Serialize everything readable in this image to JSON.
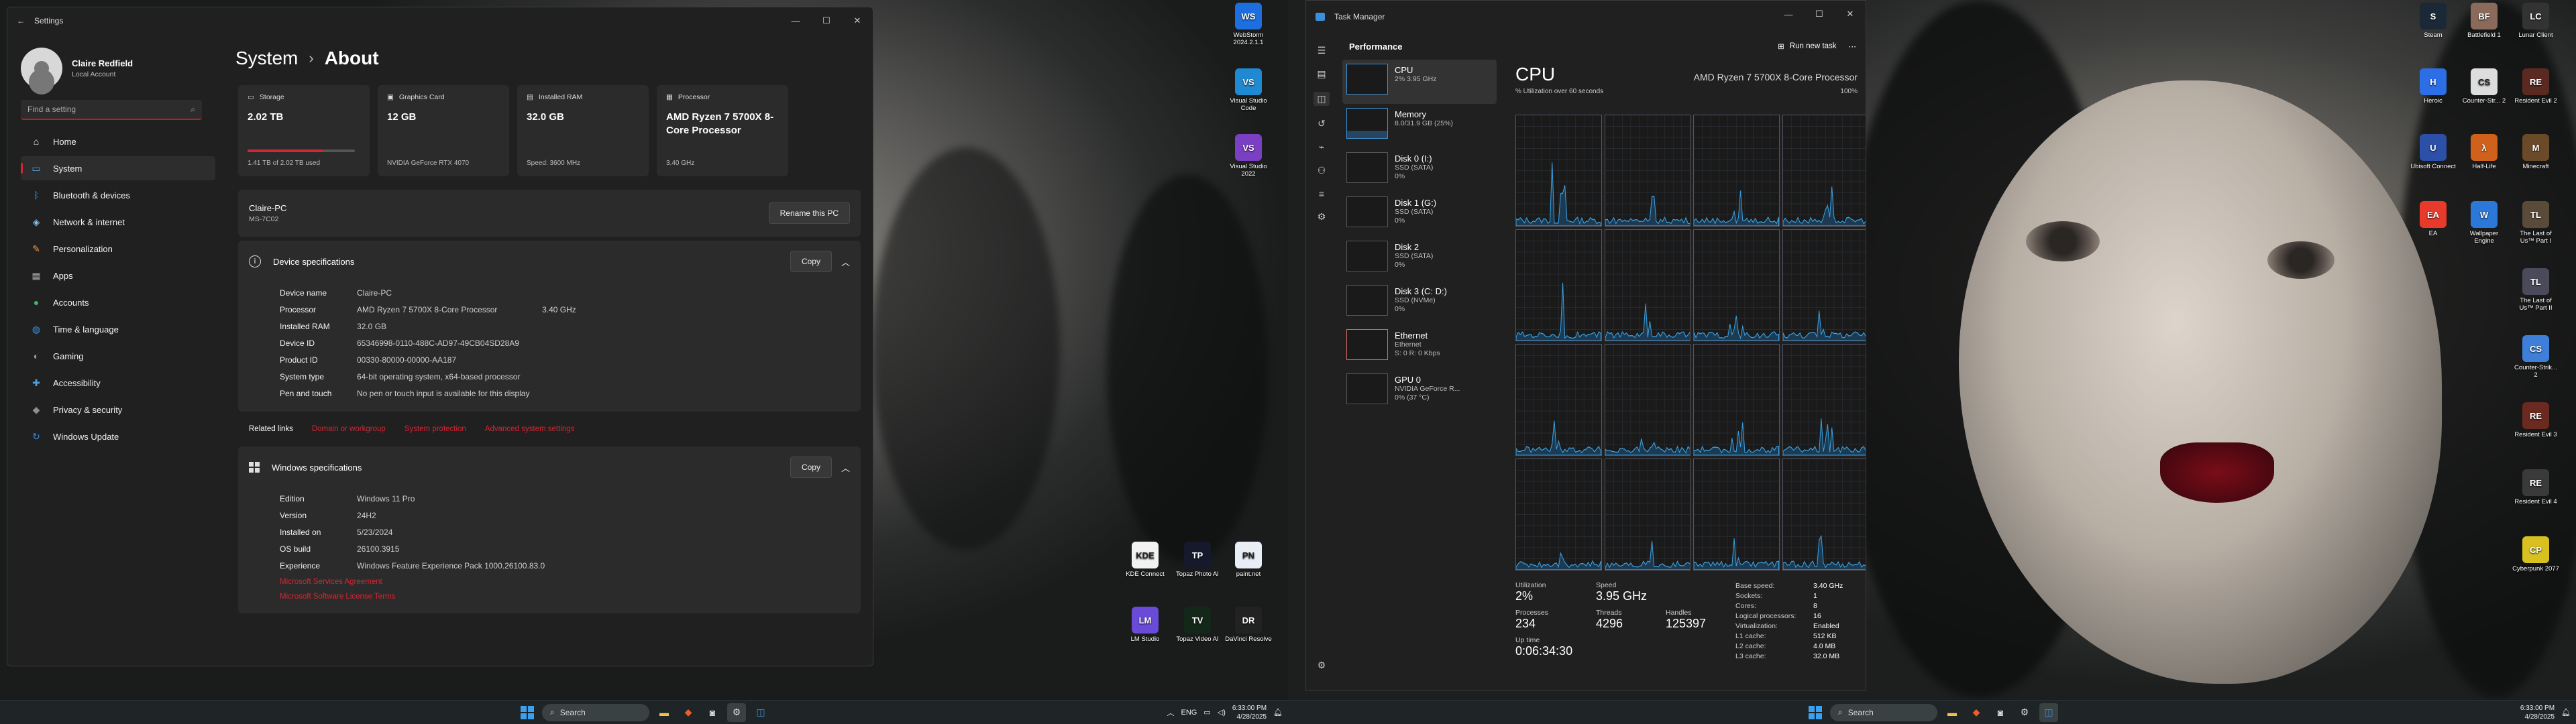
{
  "settings": {
    "title": "Settings",
    "profile": {
      "name": "Claire Redfield",
      "sub": "Local Account"
    },
    "search_placeholder": "Find a setting",
    "nav": [
      {
        "label": "Home",
        "icon": "home-icon",
        "glyph": "⌂",
        "color": "#e8e8e8"
      },
      {
        "label": "System",
        "icon": "system-icon",
        "glyph": "▭",
        "color": "#4aa3df"
      },
      {
        "label": "Bluetooth & devices",
        "icon": "bluetooth-icon",
        "glyph": "ᛒ",
        "color": "#2b8fe0"
      },
      {
        "label": "Network & internet",
        "icon": "wifi-icon",
        "glyph": "◈",
        "color": "#7dc4f5"
      },
      {
        "label": "Personalization",
        "icon": "brush-icon",
        "glyph": "✎",
        "color": "#e89a3c"
      },
      {
        "label": "Apps",
        "icon": "apps-icon",
        "glyph": "▦",
        "color": "#9aa0a6"
      },
      {
        "label": "Accounts",
        "icon": "accounts-icon",
        "glyph": "●",
        "color": "#3fb36b"
      },
      {
        "label": "Time & language",
        "icon": "globe-icon",
        "glyph": "◍",
        "color": "#3c91e6"
      },
      {
        "label": "Gaming",
        "icon": "gamepad-icon",
        "glyph": "◐",
        "color": "#9aa0a6"
      },
      {
        "label": "Accessibility",
        "icon": "accessibility-icon",
        "glyph": "✚",
        "color": "#4aa3df"
      },
      {
        "label": "Privacy & security",
        "icon": "shield-icon",
        "glyph": "◆",
        "color": "#8a8f95"
      },
      {
        "label": "Windows Update",
        "icon": "update-icon",
        "glyph": "↻",
        "color": "#2b8fe0"
      }
    ],
    "active_index": 1,
    "breadcrumb": {
      "parent": "System",
      "sep": "›",
      "current": "About"
    },
    "cards": [
      {
        "title": "Storage",
        "value": "2.02 TB",
        "sub": "1.41 TB of 2.02 TB used",
        "fill": 0.7
      },
      {
        "title": "Graphics Card",
        "value": "12 GB",
        "sub": "NVIDIA GeForce RTX 4070"
      },
      {
        "title": "Installed RAM",
        "value": "32.0 GB",
        "sub": "Speed: 3600 MHz"
      },
      {
        "title": "Processor",
        "value": "AMD Ryzen 7 5700X 8-Core Processor",
        "sub": "3.40 GHz"
      }
    ],
    "pc": {
      "name": "Claire-PC",
      "model": "MS-7C02",
      "rename": "Rename this PC"
    },
    "device_spec": {
      "title": "Device specifications",
      "copy": "Copy",
      "rows": [
        {
          "k": "Device name",
          "v": "Claire-PC"
        },
        {
          "k": "Processor",
          "v": "AMD Ryzen 7 5700X 8-Core Processor                    3.40 GHz"
        },
        {
          "k": "Installed RAM",
          "v": "32.0 GB"
        },
        {
          "k": "Device ID",
          "v": "65346998-0110-488C-AD97-49CB04SD28A9"
        },
        {
          "k": "Product ID",
          "v": "00330-80000-00000-AA187"
        },
        {
          "k": "System type",
          "v": "64-bit operating system, x64-based processor"
        },
        {
          "k": "Pen and touch",
          "v": "No pen or touch input is available for this display"
        }
      ]
    },
    "related": {
      "label": "Related links",
      "links": [
        "Domain or workgroup",
        "System protection",
        "Advanced system settings"
      ]
    },
    "win_spec": {
      "title": "Windows specifications",
      "copy": "Copy",
      "rows": [
        {
          "k": "Edition",
          "v": "Windows 11 Pro"
        },
        {
          "k": "Version",
          "v": "24H2"
        },
        {
          "k": "Installed on",
          "v": "5/23/2024"
        },
        {
          "k": "OS build",
          "v": "26100.3915"
        },
        {
          "k": "Experience",
          "v": "Windows Feature Experience Pack 1000.26100.83.0"
        }
      ],
      "links": [
        "Microsoft Services Agreement",
        "Microsoft Software License Terms"
      ]
    }
  },
  "taskmgr": {
    "title": "Task Manager",
    "section": "Performance",
    "run_task": "Run new task",
    "items": [
      {
        "name": "CPU",
        "l1": "2% 3.95 GHz",
        "l2": ""
      },
      {
        "name": "Memory",
        "l1": "8.0/31.9 GB (25%)",
        "l2": ""
      },
      {
        "name": "Disk 0 (I:)",
        "l1": "SSD (SATA)",
        "l2": "0%"
      },
      {
        "name": "Disk 1 (G:)",
        "l1": "SSD (SATA)",
        "l2": "0%"
      },
      {
        "name": "Disk 2",
        "l1": "SSD (SATA)",
        "l2": "0%"
      },
      {
        "name": "Disk 3 (C: D:)",
        "l1": "SSD (NVMe)",
        "l2": "0%"
      },
      {
        "name": "Ethernet",
        "l1": "Ethernet",
        "l2": "S: 0 R: 0 Kbps"
      },
      {
        "name": "GPU 0",
        "l1": "NVIDIA GeForce R...",
        "l2": "0% (37 °C)"
      }
    ],
    "cpu": {
      "title": "CPU",
      "proc": "AMD Ryzen 7 5700X 8-Core Processor",
      "util_label": "% Utilization over 60 seconds",
      "util_max": "100%",
      "utilization_label": "Utilization",
      "utilization": "2%",
      "speed_label": "Speed",
      "speed": "3.95 GHz",
      "processes_label": "Processes",
      "processes": "234",
      "threads_label": "Threads",
      "threads": "4296",
      "handles_label": "Handles",
      "handles": "125397",
      "uptime_label": "Up time",
      "uptime": "0:06:34:30",
      "details": [
        {
          "k": "Base speed:",
          "v": "3.40 GHz"
        },
        {
          "k": "Sockets:",
          "v": "1"
        },
        {
          "k": "Cores:",
          "v": "8"
        },
        {
          "k": "Logical processors:",
          "v": "16"
        },
        {
          "k": "Virtualization:",
          "v": "Enabled"
        },
        {
          "k": "L1 cache:",
          "v": "512 KB"
        },
        {
          "k": "L2 cache:",
          "v": "4.0 MB"
        },
        {
          "k": "L3 cache:",
          "v": "32.0 MB"
        }
      ]
    }
  },
  "taskbar": {
    "search": "Search",
    "lang": "ENG",
    "time": "6:33:00 PM",
    "date": "4/28/2025"
  },
  "desktop_left": [
    {
      "label": "WebStorm 2024.2.1.1",
      "abbr": "WS",
      "color": "#1d6fe0"
    },
    {
      "label": "Visual Studio Code",
      "abbr": "VS",
      "color": "#1f8ad2"
    },
    {
      "label": "Visual Studio 2022",
      "abbr": "VS",
      "color": "#7b3fc4"
    },
    {
      "label": "KDE Connect",
      "abbr": "KDE",
      "color": "#f2f2f2"
    },
    {
      "label": "Topaz Photo AI",
      "abbr": "TP",
      "color": "#15192b"
    },
    {
      "label": "paint.net",
      "abbr": "PN",
      "color": "#e9eef7"
    },
    {
      "label": "LM Studio",
      "abbr": "LM",
      "color": "#6a4bd8"
    },
    {
      "label": "Topaz Video AI",
      "abbr": "TV",
      "color": "#14281a"
    },
    {
      "label": "DaVinci Resolve",
      "abbr": "DR",
      "color": "#222"
    }
  ],
  "desktop_right": [
    {
      "label": "Steam",
      "abbr": "S",
      "color": "#1b2838"
    },
    {
      "label": "Battlefield 1",
      "abbr": "BF",
      "color": "#8a6a5a"
    },
    {
      "label": "Lunar Client",
      "abbr": "LC",
      "color": "#333"
    },
    {
      "label": "Heroic",
      "abbr": "H",
      "color": "#2b6ee6"
    },
    {
      "label": "Counter-Str... 2",
      "abbr": "CS",
      "color": "#ddd"
    },
    {
      "label": "Resident Evil 2",
      "abbr": "RE",
      "color": "#5a2a22"
    },
    {
      "label": "Ubisoft Connect",
      "abbr": "U",
      "color": "#2c4fa8"
    },
    {
      "label": "Half-Life",
      "abbr": "λ",
      "color": "#d0611c"
    },
    {
      "label": "Minecraft",
      "abbr": "M",
      "color": "#6b4a2a"
    },
    {
      "label": "EA",
      "abbr": "EA",
      "color": "#e83a2a"
    },
    {
      "label": "Wallpaper Engine",
      "abbr": "W",
      "color": "#2b78d8"
    },
    {
      "label": "The Last of Us™ Part I",
      "abbr": "TL",
      "color": "#5a4a3a"
    },
    {
      "label": "The Last of Us™ Part II",
      "abbr": "TL",
      "color": "#4a4a5a"
    },
    {
      "label": "Counter-Strik... 2",
      "abbr": "CS",
      "color": "#3d7fd9"
    },
    {
      "label": "Resident Evil 3",
      "abbr": "RE",
      "color": "#6a2a20"
    },
    {
      "label": "Resident Evil 4",
      "abbr": "RE",
      "color": "#3a3a3a"
    },
    {
      "label": "Cyberpunk 2077",
      "abbr": "CP",
      "color": "#d8c020"
    }
  ]
}
